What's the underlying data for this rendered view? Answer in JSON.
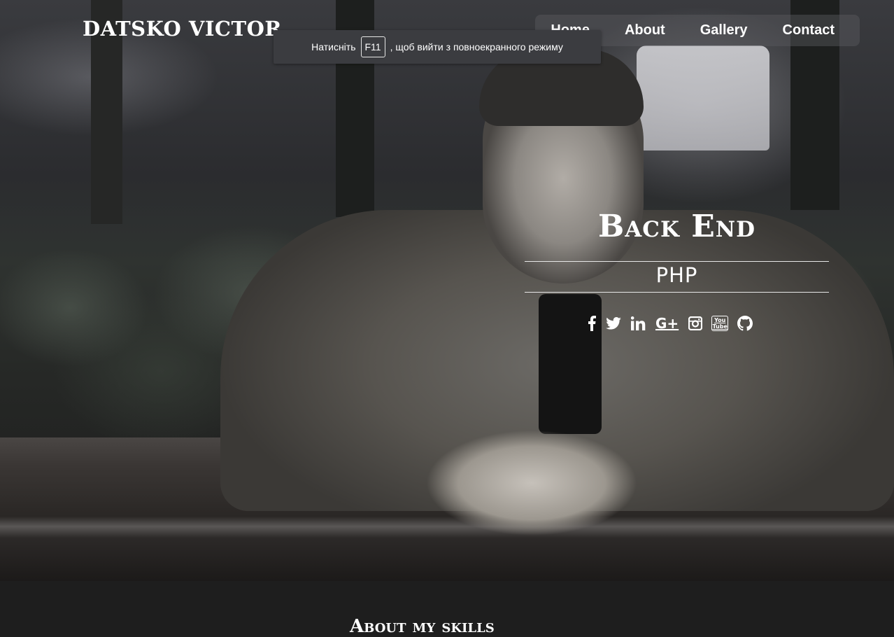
{
  "brand": {
    "name": "DATSKO VICTOR"
  },
  "nav": {
    "items": [
      {
        "label": "Home"
      },
      {
        "label": "About"
      },
      {
        "label": "Gallery"
      },
      {
        "label": "Contact"
      }
    ]
  },
  "toast": {
    "prefix": "Натисніть",
    "key": "F11",
    "suffix": ", щоб вийти з повноекранного режиму"
  },
  "hero": {
    "title": "Back End",
    "subtitle": "PHP",
    "socials": [
      {
        "icon": "facebook-icon"
      },
      {
        "icon": "twitter-icon"
      },
      {
        "icon": "linkedin-icon"
      },
      {
        "icon": "google-plus-icon",
        "text": "G+"
      },
      {
        "icon": "instagram-icon"
      },
      {
        "icon": "youtube-icon",
        "text": "You Tube"
      },
      {
        "icon": "github-icon"
      }
    ]
  },
  "about": {
    "title": "About my skills"
  }
}
